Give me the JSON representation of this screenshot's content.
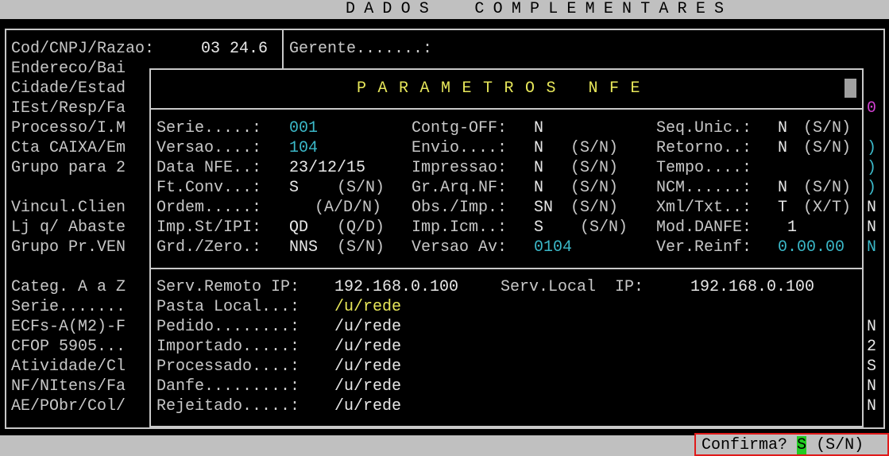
{
  "header": {
    "title": "DADOS  COMPLEMENTARES"
  },
  "background_form": {
    "cod_label": "Cod/CNPJ/Razao:",
    "cod_value": "03 24.6",
    "gerente_label": "Gerente.......:",
    "left_labels": [
      "Endereco/Bai",
      "Cidade/Estad",
      "IEst/Resp/Fa",
      "Processo/I.M",
      "Cta CAIXA/Em",
      "Grupo para 2",
      "",
      "Vincul.Clien",
      "Lj q/ Abaste",
      "Grupo Pr.VEN",
      "",
      "Categ. A a Z",
      "Serie.......",
      "ECFs-A(M2)-F",
      "CFOP 5905...",
      "Atividade/Cl",
      "NF/NItens/Fa",
      "AE/PObr/Col/"
    ],
    "right_edge_values": [
      {
        "row": 3,
        "text": "0",
        "color": "magenta"
      },
      {
        "row": 5,
        "text": ")",
        "color": "cyan"
      },
      {
        "row": 6,
        "text": ")",
        "color": "cyan"
      },
      {
        "row": 7,
        "text": ")",
        "color": "cyan"
      },
      {
        "row": 8,
        "text": "N",
        "color": "white"
      },
      {
        "row": 9,
        "text": "N",
        "color": "white"
      },
      {
        "row": 10,
        "text": "N",
        "color": "cyan"
      },
      {
        "row": 14,
        "text": "N",
        "color": "white"
      },
      {
        "row": 15,
        "text": "2",
        "color": "white"
      },
      {
        "row": 16,
        "text": "S",
        "color": "white"
      },
      {
        "row": 17,
        "text": "N",
        "color": "white"
      },
      {
        "row": 18,
        "text": "N",
        "color": "white"
      }
    ]
  },
  "popup": {
    "title": "PARAMETROS NFE",
    "col1": [
      {
        "label": "Serie.....:",
        "value": "001",
        "color": "cyan",
        "hint": ""
      },
      {
        "label": "Versao....:",
        "value": "104",
        "color": "cyan",
        "hint": ""
      },
      {
        "label": "Data NFE..:",
        "value": "23/12/15",
        "color": "white",
        "hint": ""
      },
      {
        "label": "Ft.Conv...:",
        "value": "S",
        "color": "white",
        "hint": "(S/N)"
      },
      {
        "label": "Ordem.....:",
        "value": "",
        "color": "white",
        "hint": "(A/D/N)"
      },
      {
        "label": "Imp.St/IPI:",
        "value": "QD",
        "color": "white",
        "hint": "(Q/D)"
      },
      {
        "label": "Grd./Zero.:",
        "value": "NNS",
        "color": "white",
        "hint": "(S/N)"
      }
    ],
    "col2": [
      {
        "label": "Contg-OFF:",
        "value": "N",
        "color": "white",
        "hint": ""
      },
      {
        "label": "Envio....:",
        "value": "N",
        "color": "white",
        "hint": "(S/N)"
      },
      {
        "label": "Impressao:",
        "value": "N",
        "color": "white",
        "hint": "(S/N)"
      },
      {
        "label": "Gr.Arq.NF:",
        "value": "N",
        "color": "white",
        "hint": "(S/N)"
      },
      {
        "label": "Obs./Imp.:",
        "value": "SN",
        "color": "white",
        "hint": "(S/N)"
      },
      {
        "label": "Imp.Icm..:",
        "value": "S",
        "color": "white",
        "hint": " (S/N)"
      },
      {
        "label": "Versao Av:",
        "value": "0104",
        "color": "cyan",
        "hint": ""
      }
    ],
    "col3": [
      {
        "label": "Seq.Unic.:",
        "value": "N",
        "color": "white",
        "hint": "(S/N)"
      },
      {
        "label": "Retorno..:",
        "value": "N",
        "color": "white",
        "hint": "(S/N)"
      },
      {
        "label": "Tempo....:",
        "value": "",
        "color": "white",
        "hint": ""
      },
      {
        "label": "NCM......:",
        "value": "N",
        "color": "white",
        "hint": "(S/N)"
      },
      {
        "label": "Xml/Txt..:",
        "value": "T",
        "color": "white",
        "hint": "(X/T)"
      },
      {
        "label": "Mod.DANFE:",
        "value": " 1",
        "color": "white",
        "hint": ""
      },
      {
        "label": "Ver.Reinf:",
        "value": "0.00.00",
        "color": "cyan",
        "hint": ""
      }
    ],
    "serv_remoto_label": "Serv.Remoto IP:",
    "serv_remoto_value": "192.168.0.100",
    "serv_local_label": "Serv.Local  IP:",
    "serv_local_value": "192.168.0.100",
    "paths": [
      {
        "label": "Pasta Local...:",
        "value": "/u/rede",
        "color": "yellow"
      },
      {
        "label": "Pedido........:",
        "value": "/u/rede",
        "color": "white"
      },
      {
        "label": "Importado.....:",
        "value": "/u/rede",
        "color": "white"
      },
      {
        "label": "Processado....:",
        "value": "/u/rede",
        "color": "white"
      },
      {
        "label": "Danfe.........:",
        "value": "/u/rede",
        "color": "white"
      },
      {
        "label": "Rejeitado.....:",
        "value": "/u/rede",
        "color": "white"
      }
    ]
  },
  "footer": {
    "confirm_label": "Confirma?",
    "confirm_value": "S",
    "confirm_hint": "(S/N)"
  }
}
